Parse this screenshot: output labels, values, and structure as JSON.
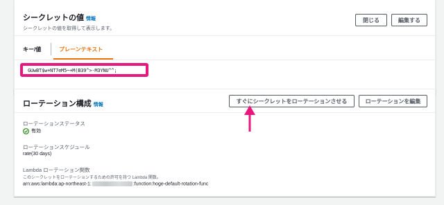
{
  "secret_panel": {
    "title": "シークレットの値",
    "info": "情報",
    "subtitle": "シークレットの値を取得して表示します。",
    "close_button": "閉じる",
    "edit_button": "編集する",
    "tabs": [
      {
        "label": "キー/値",
        "active": false
      },
      {
        "label": "プレーンテキスト",
        "active": true
      }
    ],
    "secret_value": "GUwBT$w+NT7eM5~+M(B39^>-M3YNU^^;"
  },
  "rotation_panel": {
    "title": "ローテーション構成",
    "info": "情報",
    "rotate_now_button": "すぐにシークレットをローテーションさせる",
    "edit_rotation_button": "ローテーションを編集",
    "status_label": "ローテーションステータス",
    "status_value": "有効",
    "schedule_label": "ローテーションスケジュール",
    "schedule_value": "rate(30 days)",
    "lambda_label": "Lambda ローテーション関数",
    "lambda_desc": "このシークレットをローテーションするための許可を持つ Lambda 関数。",
    "lambda_arn_prefix": "arn:aws:lambda:ap-northeast-1:",
    "lambda_arn_suffix": ":function:hoge-default-rotation-func"
  },
  "colors": {
    "accent": "#ec7211",
    "highlight": "#e8177d",
    "success": "#1d8102",
    "link": "#0073bb"
  }
}
